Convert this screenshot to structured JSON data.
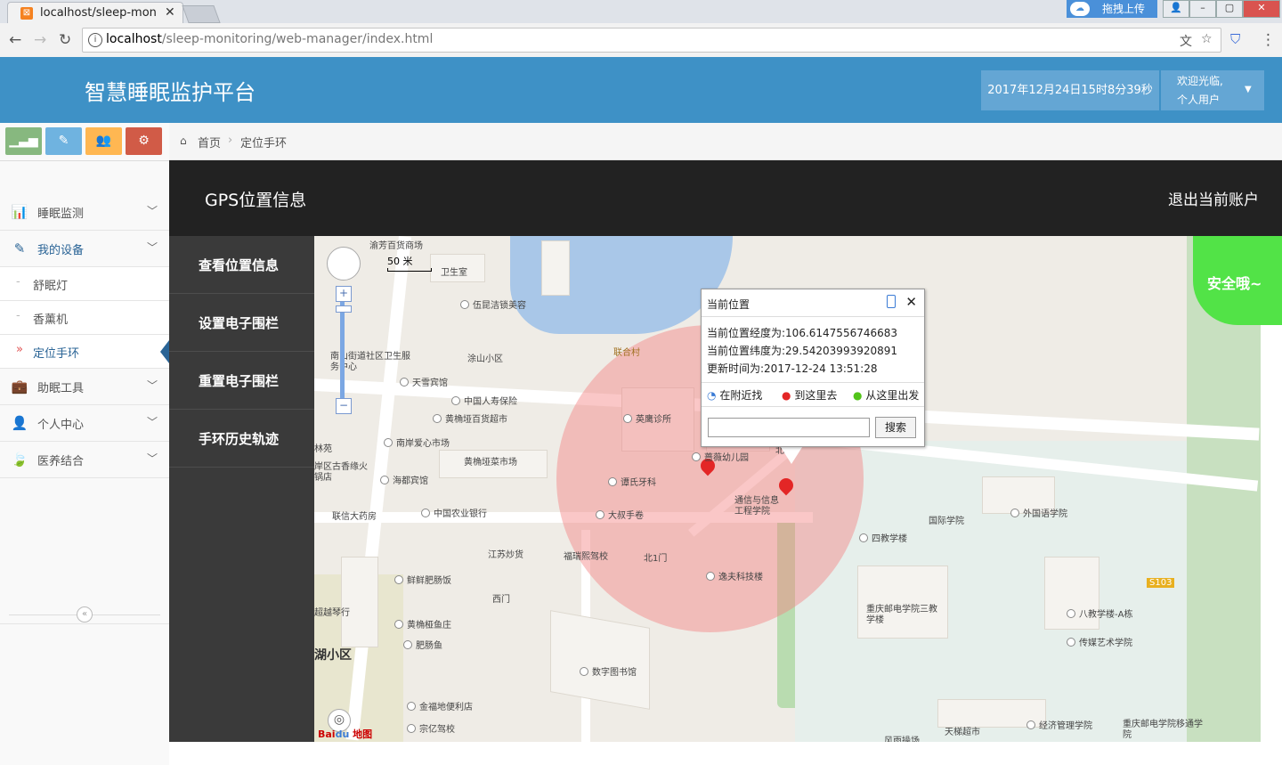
{
  "browser": {
    "tab_title": "localhost/sleep-monitc",
    "url_host": "localhost",
    "url_path": "/sleep-monitoring/web-manager/index.html",
    "upload_label": "拖拽上传"
  },
  "header": {
    "app_title": "智慧睡眠监护平台",
    "datetime": "2017年12月24日15时8分39秒",
    "welcome_line1": "欢迎光临,",
    "welcome_line2": "个人用户"
  },
  "shortcuts": [
    {
      "icon": "signal-icon",
      "color": "#5cb85c"
    },
    {
      "icon": "pencil-icon",
      "color": "#5bc0de"
    },
    {
      "icon": "users-icon",
      "color": "#f0ad4e"
    },
    {
      "icon": "cogs-icon",
      "color": "#d9534f"
    }
  ],
  "sidebar": {
    "items": [
      {
        "label": "睡眠监测",
        "icon": "bar-chart-icon"
      },
      {
        "label": "我的设备",
        "icon": "pencil-icon"
      },
      {
        "label": "助眠工具",
        "icon": "briefcase-icon"
      },
      {
        "label": "个人中心",
        "icon": "user-icon"
      },
      {
        "label": "医养结合",
        "icon": "leaf-icon"
      }
    ],
    "subitems": [
      {
        "label": "舒眠灯"
      },
      {
        "label": "香薰机"
      },
      {
        "label": "定位手环"
      }
    ]
  },
  "breadcrumb": {
    "home": "首页",
    "current": "定位手环"
  },
  "gps": {
    "title": "GPS位置信息",
    "logout": "退出当前账户",
    "menu": [
      "查看位置信息",
      "设置电子围栏",
      "重置电子围栏",
      "手环历史轨迹"
    ],
    "safe_status": "安全哦~"
  },
  "map": {
    "scale_label": "50 米",
    "pois": [
      "渝芳百货商场",
      "卫生室",
      "伍昆洁锁美容",
      "涂山小区",
      "联合村",
      "南山街道社区卫生服务中心",
      "天雪宾馆",
      "中国人寿保险",
      "黄桷垭百货超市",
      "英鹰诊所",
      "南岸爱心市场",
      "黄桷垭菜市场",
      "蔷薇幼儿园",
      "岸区古香缘火锅店",
      "海都宾馆",
      "谭氏牙科",
      "通信与信息工程学院",
      "联信大药房",
      "中国农业银行",
      "大叔手卷",
      "国际学院",
      "外国语学院",
      "四教学楼",
      "江苏炒货",
      "福瑞熙驾校",
      "北1门",
      "逸夫科技楼",
      "鲜鲜肥肠饭",
      "西门",
      "超越琴行",
      "黄桷桠鱼庄",
      "肥肠鱼",
      "重庆邮电学院三教学楼",
      "八教学楼-A栋",
      "传媒艺术学院",
      "数字图书馆",
      "金福地便利店",
      "宗亿驾校",
      "天梯超市",
      "经济管理学院",
      "重庆邮电学院移通学院",
      "风雨操场",
      "S103",
      "湖小区",
      "林苑",
      "北门"
    ],
    "brand": "地图"
  },
  "popup": {
    "title": "当前位置",
    "lng_label": "当前位置经度为:",
    "lng": "106.6147556746683",
    "lat_label": "当前位置纬度为:",
    "lat": "29.54203993920891",
    "time_label": "更新时间为:",
    "time": "2017-12-24 13:51:28",
    "nearby": "在附近找",
    "go_here": "到这里去",
    "from_here": "从这里出发",
    "search": "搜索"
  }
}
